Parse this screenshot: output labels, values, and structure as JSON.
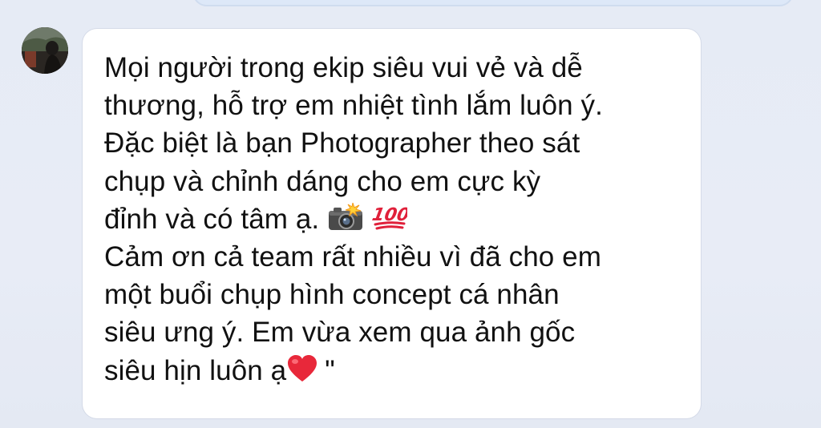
{
  "message": {
    "lines": [
      "Mọi người trong ekip siêu vui vẻ và dễ",
      "thương, hỗ trợ em nhiệt tình lắm luôn ý.",
      "Đặc biệt là bạn Photographer theo sát",
      "chụp và chỉnh dáng cho em cực kỳ",
      "đỉnh và có tâm ạ.",
      "Cảm ơn cả team rất nhiều vì đã cho em",
      "một buổi chụp hình concept cá nhân",
      "siêu ưng ý. Em vừa xem qua ảnh gốc",
      "siêu hịn luôn ạ",
      "\""
    ],
    "emojis": [
      "camera-flash-icon",
      "hundred-points-icon",
      "red-heart-icon"
    ]
  },
  "colors": {
    "background": "#e6ebf5",
    "bubble": "#ffffff",
    "text": "#111111",
    "hundred": "#e0203a",
    "heart": "#e8283a"
  }
}
